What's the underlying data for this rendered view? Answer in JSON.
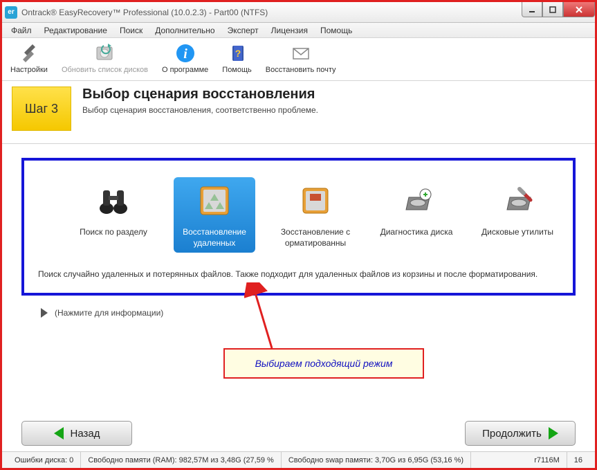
{
  "window": {
    "title": "Ontrack® EasyRecovery™ Professional (10.0.2.3) - Part00 (NTFS)",
    "app_icon_text": "er"
  },
  "menu": [
    "Файл",
    "Редактирование",
    "Поиск",
    "Дополнительно",
    "Эксперт",
    "Лицензия",
    "Помощь"
  ],
  "toolbar": {
    "settings": "Настройки",
    "refresh": "Обновить список дисков",
    "about": "О программе",
    "help": "Помощь",
    "mail": "Восстановить почту"
  },
  "step": {
    "badge": "Шаг 3",
    "title": "Выбор сценария восстановления",
    "subtitle": "Выбор сценария восстановления, соответственно проблеме."
  },
  "options": [
    {
      "label": "Поиск по разделу"
    },
    {
      "label": "Восстановление удаленных"
    },
    {
      "label": "Зосстановление с орматированны"
    },
    {
      "label": "Диагностика диска"
    },
    {
      "label": "Дисковые утилиты"
    }
  ],
  "description": "Поиск случайно удаленных и потерянных файлов. Также подходит для удаленных файлов из корзины и после форматирования.",
  "info_hint": "(Нажмите для информации)",
  "callout": "Выбираем подходящий режим",
  "nav": {
    "back": "Назад",
    "next": "Продолжить"
  },
  "status": {
    "errors": "Ошибки диска: 0",
    "ram": "Свободно памяти (RAM): 982,57M из 3,48G (27,59 %",
    "swap": "Свободно swap памяти: 3,70G из 6,95G (53,16 %)",
    "code": "r7116M",
    "num": "16"
  }
}
